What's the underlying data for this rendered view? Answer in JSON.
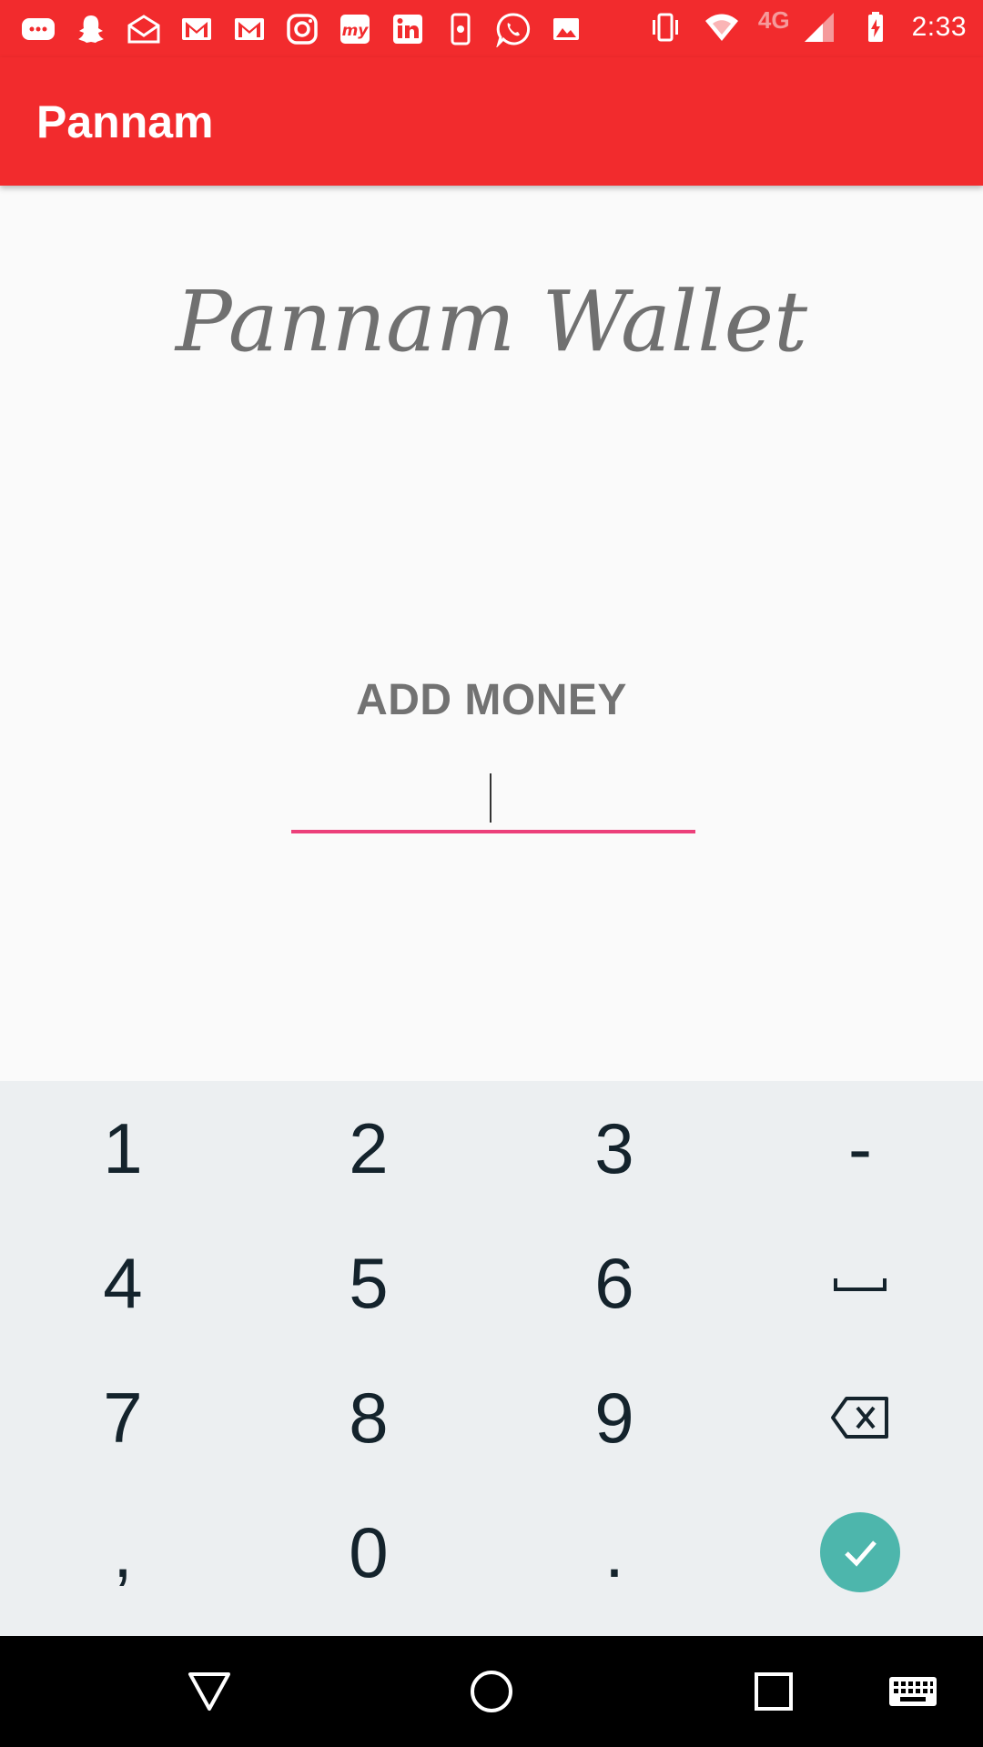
{
  "status_bar": {
    "time": "2:33",
    "network": "4G",
    "notification_icons": [
      "messages-icon",
      "snapchat-icon",
      "mail-open-icon",
      "gmail-icon",
      "gmail-icon",
      "instagram-icon",
      "mytoken-icon",
      "linkedin-icon",
      "phone-app-icon",
      "whatsapp-icon",
      "image-icon"
    ],
    "system_icons": [
      "vibrate-icon",
      "wifi-icon",
      "signal-icon",
      "battery-charging-icon"
    ]
  },
  "app_bar": {
    "title": "Pannam"
  },
  "main": {
    "wallet_title": "Pannam Wallet",
    "add_money_label": "ADD MONEY",
    "amount_input": {
      "value": "",
      "placeholder": ""
    }
  },
  "keypad": {
    "keys": [
      [
        "1",
        "2",
        "3",
        "-"
      ],
      [
        "4",
        "5",
        "6",
        "space"
      ],
      [
        "7",
        "8",
        "9",
        "backspace"
      ],
      [
        ",",
        "0",
        ".",
        "done"
      ]
    ]
  },
  "nav_bar": {
    "buttons": [
      "back-icon",
      "home-icon",
      "recents-icon",
      "keyboard-icon"
    ]
  },
  "colors": {
    "app_bar": "#f22b2d",
    "accent": "#ec407a",
    "done": "#4db6ac",
    "keypad_bg": "#eceff1"
  }
}
